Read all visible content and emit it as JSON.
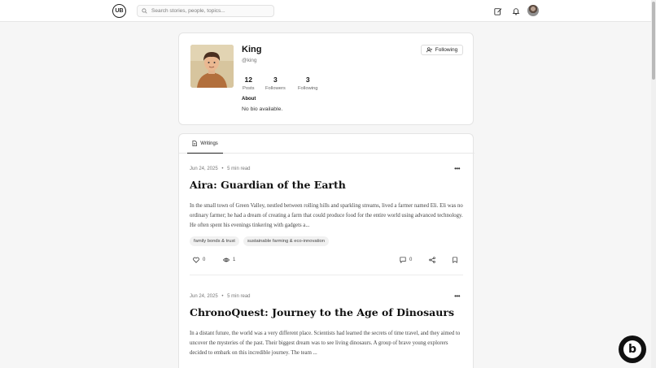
{
  "header": {
    "logo_text": "UB",
    "search_placeholder": "Search stories, people, topics...",
    "icons": [
      "write-icon",
      "bell-icon",
      "avatar"
    ]
  },
  "profile": {
    "name": "King",
    "handle": "@king",
    "follow_button": "Following",
    "stats": [
      {
        "value": "12",
        "label": "Posts"
      },
      {
        "value": "3",
        "label": "Followers"
      },
      {
        "value": "3",
        "label": "Following"
      }
    ],
    "about_heading": "About",
    "about_text": "No bio available."
  },
  "tabs": [
    {
      "label": "Writings",
      "active": true
    }
  ],
  "posts": [
    {
      "date": "Jun 24, 2025",
      "read_time": "5 min read",
      "title": "Aira: Guardian of the Earth",
      "excerpt": "In the small town of Green Valley, nestled between rolling hills and sparkling streams, lived a farmer named Eli. Eli was no ordinary farmer; he had a dream of creating a farm that could produce food for the entire world using advanced technology. He often spent his evenings tinkering with gadgets a...",
      "tags": [
        "family bonds & trust",
        "sustainable farming & eco-innovation"
      ],
      "likes": "0",
      "views": "1",
      "comments": "0"
    },
    {
      "date": "Jun 24, 2025",
      "read_time": "5 min read",
      "title": "ChronoQuest: Journey to the Age of Dinosaurs",
      "excerpt": "In a distant future, the world was a very different place. Scientists had learned the secrets of time travel, and they aimed to uncover the mysteries of the past. Their biggest dream was to see living dinosaurs. A group of brave young explorers decided to embark on this incredible journey. The team ..."
    }
  ],
  "meta_separator": "•",
  "badge_letter": "b",
  "colors": {
    "background": "#f6f6f6",
    "card": "#ffffff",
    "text": "#111111",
    "muted": "#777777"
  }
}
